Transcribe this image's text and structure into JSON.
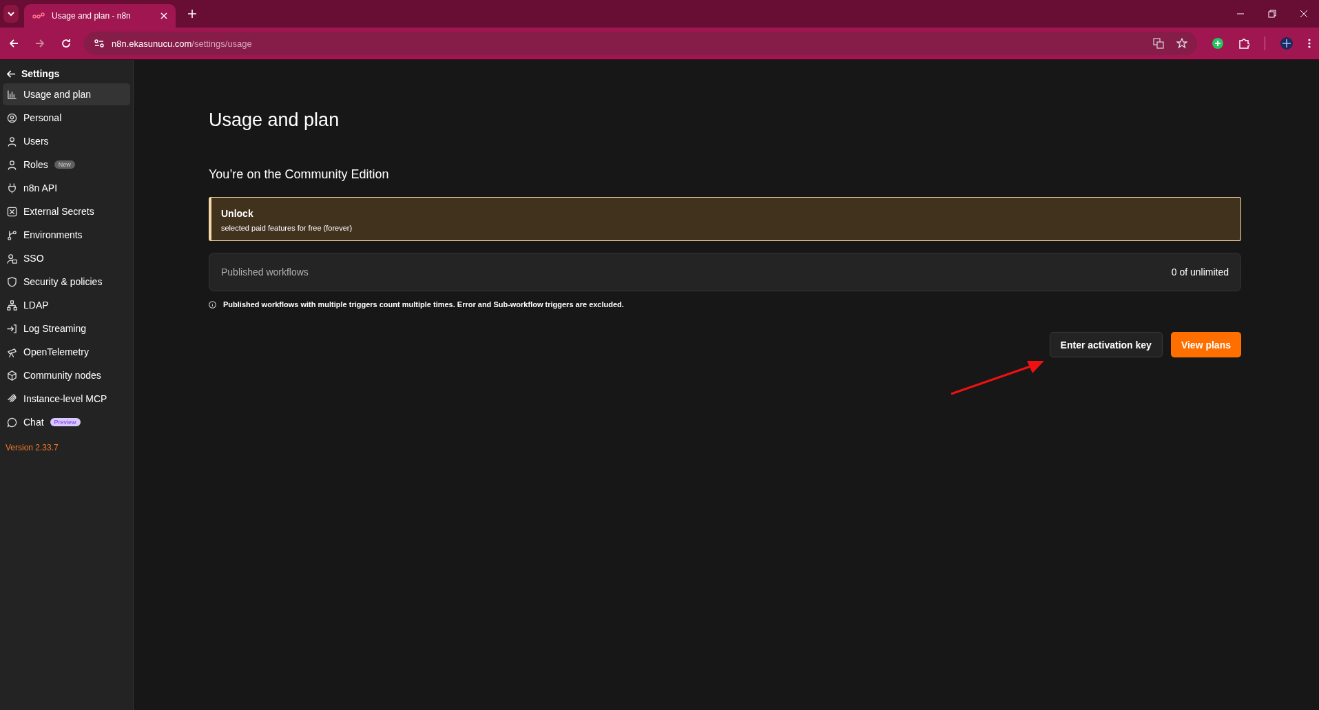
{
  "browser": {
    "tab_title": "Usage and plan - n8n",
    "url_host": "n8n.ekasunucu.com",
    "url_path": "/settings/usage"
  },
  "sidebar": {
    "back_label": "Settings",
    "items": [
      {
        "label": "Usage and plan",
        "selected": true
      },
      {
        "label": "Personal",
        "selected": false
      },
      {
        "label": "Users",
        "selected": false
      },
      {
        "label": "Roles",
        "selected": false,
        "badge": {
          "text": "New",
          "kind": "new"
        }
      },
      {
        "label": "n8n API",
        "selected": false
      },
      {
        "label": "External Secrets",
        "selected": false
      },
      {
        "label": "Environments",
        "selected": false
      },
      {
        "label": "SSO",
        "selected": false
      },
      {
        "label": "Security & policies",
        "selected": false
      },
      {
        "label": "LDAP",
        "selected": false
      },
      {
        "label": "Log Streaming",
        "selected": false
      },
      {
        "label": "OpenTelemetry",
        "selected": false
      },
      {
        "label": "Community nodes",
        "selected": false
      },
      {
        "label": "Instance-level MCP",
        "selected": false
      },
      {
        "label": "Chat",
        "selected": false,
        "badge": {
          "text": "Preview",
          "kind": "preview"
        }
      }
    ],
    "version": "Version 2.33.7"
  },
  "main": {
    "title": "Usage and plan",
    "subtitle": "You’re on the Community Edition",
    "callout": {
      "title": "Unlock",
      "text": "selected paid features for free (forever)"
    },
    "usage": {
      "label": "Published workflows",
      "value": "0 of unlimited"
    },
    "note": "Published workflows with multiple triggers count multiple times. Error and Sub-workflow triggers are excluded.",
    "buttons": [
      {
        "label": "Enter activation key",
        "kind": "secondary"
      },
      {
        "label": "View plans",
        "kind": "primary"
      }
    ]
  }
}
